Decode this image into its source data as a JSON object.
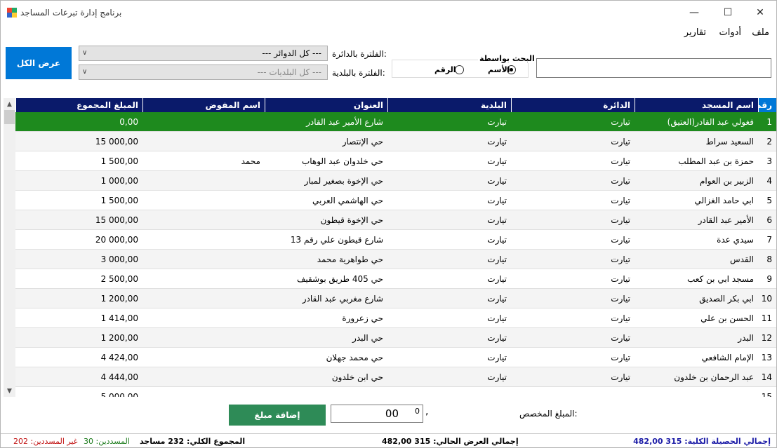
{
  "window": {
    "title": "برنامج إدارة تبرعات المساجد"
  },
  "menu": [
    "ملف",
    "أدوات",
    "تقارير"
  ],
  "search": {
    "legend": "البحث بواسطة",
    "option_name": "الأسم",
    "option_number": "الرقم",
    "selected": "name"
  },
  "filters": {
    "district_label": "الفلترة بالدائرة:",
    "district_value": "--- كل الدوائر ---",
    "municipality_label": "الفلترة بالبلدية:",
    "municipality_value": "--- كل البلديات ---"
  },
  "show_all_label": "عرض الكل",
  "table": {
    "columns": [
      "رقم",
      "اسم المسجد",
      "الدائرة",
      "البلدية",
      "العنوان",
      "اسم المفوض",
      "المبلغ المجموع"
    ],
    "rows": [
      {
        "num": "1",
        "name": "فغولي عبد القادر(العتيق)",
        "district": "تيارت",
        "municipality": "تيارت",
        "address": "شارع الأمير عبد القادر",
        "delegate": "",
        "amount": "0,00"
      },
      {
        "num": "2",
        "name": "السعيد  سراط",
        "district": "تيارت",
        "municipality": "تيارت",
        "address": "حي الإنتصار",
        "delegate": "",
        "amount": "15 000,00"
      },
      {
        "num": "3",
        "name": "حمزة بن عبد المطلب",
        "district": "تيارت",
        "municipality": "تيارت",
        "address": "حي خلدوان عبد الوهاب",
        "delegate": "محمد",
        "amount": "1 500,00"
      },
      {
        "num": "4",
        "name": "الزبير بن العوام",
        "district": "تيارت",
        "municipality": "تيارت",
        "address": "حي الإخوة بصغير لمبار",
        "delegate": "",
        "amount": "1 000,00"
      },
      {
        "num": "5",
        "name": "ابي حامد الغزالي",
        "district": "تيارت",
        "municipality": "تيارت",
        "address": "حي الهاشمي العربي",
        "delegate": "",
        "amount": "1 500,00"
      },
      {
        "num": "6",
        "name": "الأمير عبد القادر",
        "district": "تيارت",
        "municipality": "تيارت",
        "address": "حي الإخوة قيطون",
        "delegate": "",
        "amount": "15 000,00"
      },
      {
        "num": "7",
        "name": "سيدي عدة",
        "district": "تيارت",
        "municipality": "تيارت",
        "address": "شارع قيطون علي رقم 13",
        "delegate": "",
        "amount": "20 000,00"
      },
      {
        "num": "8",
        "name": "القدس",
        "district": "تيارت",
        "municipality": "تيارت",
        "address": "حي طواهرية محمد",
        "delegate": "",
        "amount": "3 000,00"
      },
      {
        "num": "9",
        "name": "مسجد ابي بن كعب",
        "district": "تيارت",
        "municipality": "تيارت",
        "address": "حي 405 طريق بوشقيف",
        "delegate": "",
        "amount": "2 500,00"
      },
      {
        "num": "10",
        "name": "ابي بكر الصديق",
        "district": "تيارت",
        "municipality": "تيارت",
        "address": "شارع مغربي عبد القادر",
        "delegate": "",
        "amount": "1 200,00"
      },
      {
        "num": "11",
        "name": "الحسن بن علي",
        "district": "تيارت",
        "municipality": "تيارت",
        "address": "حي زعرورة",
        "delegate": "",
        "amount": "1 414,00"
      },
      {
        "num": "12",
        "name": "البدر",
        "district": "تيارت",
        "municipality": "تيارت",
        "address": "حي البدر",
        "delegate": "",
        "amount": "1 200,00"
      },
      {
        "num": "13",
        "name": "الإمام الشافعي",
        "district": "تيارت",
        "municipality": "تيارت",
        "address": "حي محمد جهلان",
        "delegate": "",
        "amount": "4 424,00"
      },
      {
        "num": "14",
        "name": "عبد الرحمان بن خلدون",
        "district": "تيارت",
        "municipality": "تيارت",
        "address": "حي ابن خلدون",
        "delegate": "",
        "amount": "4 444,00"
      },
      {
        "num": "15",
        "name": "",
        "district": "",
        "municipality": "",
        "address": "",
        "delegate": "",
        "amount": "5 000,00"
      }
    ],
    "selected_row": 0
  },
  "amount": {
    "label": "المبلغ المخصص:",
    "value": "00",
    "spin_value": "0",
    "comma": ","
  },
  "add_button_label": "إضافة مبلغ",
  "status": {
    "total_collection": "إجمالي الحصيلة الكلية: 315 482,00",
    "current_display_total": "إجمالي العرض الحالي: 315 482,00",
    "total_count": "المجموع الكلي: 232 مساجد",
    "paid": "المسددين: 30",
    "unpaid": "غير المسددين: 202"
  },
  "colors": {
    "header": "#0a1a6a",
    "selected_row": "#1e8a1e",
    "accent": "#0078d7",
    "add_button": "#2e8b57",
    "status_blue": "#1a1aa6",
    "status_green": "#1a7a1a",
    "status_red": "#c01010"
  }
}
